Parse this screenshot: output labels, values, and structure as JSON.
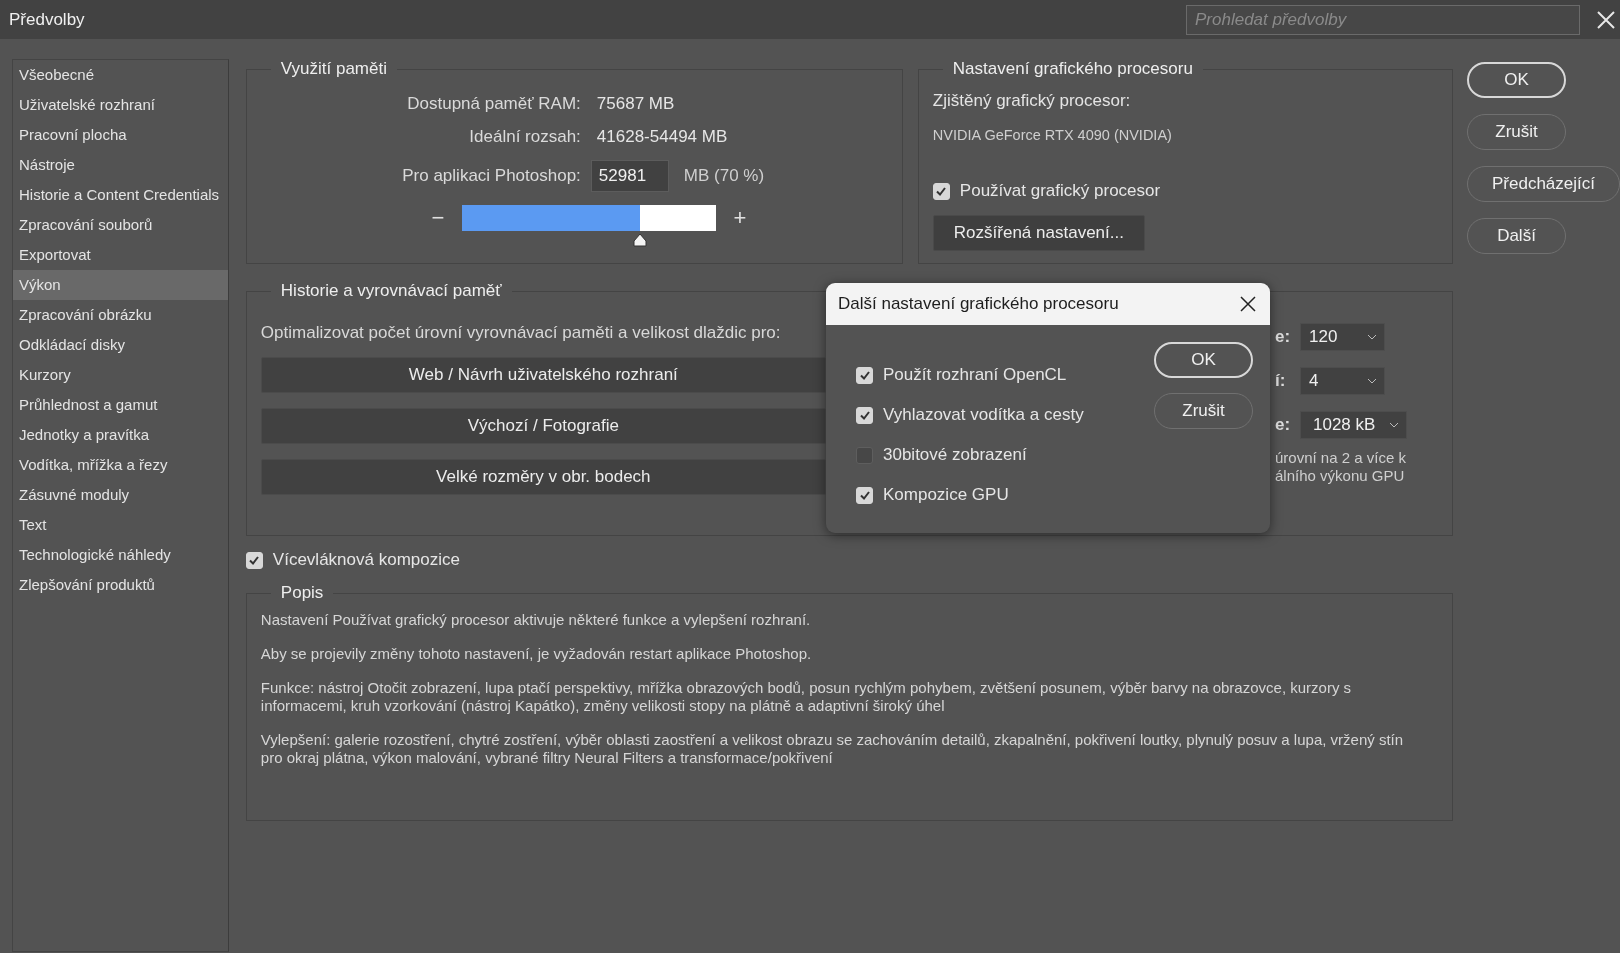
{
  "window": {
    "title": "Předvolby"
  },
  "search": {
    "placeholder": "Prohledat předvolby"
  },
  "sidebar": {
    "items": [
      {
        "label": "Všeobecné",
        "selected": false
      },
      {
        "label": "Uživatelské rozhraní",
        "selected": false
      },
      {
        "label": "Pracovní plocha",
        "selected": false
      },
      {
        "label": "Nástroje",
        "selected": false
      },
      {
        "label": "Historie a Content Credentials",
        "selected": false
      },
      {
        "label": "Zpracování souborů",
        "selected": false
      },
      {
        "label": "Exportovat",
        "selected": false
      },
      {
        "label": "Výkon",
        "selected": true
      },
      {
        "label": "Zpracování obrázku",
        "selected": false
      },
      {
        "label": "Odkládací disky",
        "selected": false
      },
      {
        "label": "Kurzory",
        "selected": false
      },
      {
        "label": "Průhlednost a gamut",
        "selected": false
      },
      {
        "label": "Jednotky a pravítka",
        "selected": false
      },
      {
        "label": "Vodítka, mřížka a řezy",
        "selected": false
      },
      {
        "label": "Zásuvné moduly",
        "selected": false
      },
      {
        "label": "Text",
        "selected": false
      },
      {
        "label": "Technologické náhledy",
        "selected": false
      },
      {
        "label": "Zlepšování produktů",
        "selected": false
      }
    ]
  },
  "memory": {
    "title": "Využití paměti",
    "rows": [
      {
        "label": "Dostupná paměť RAM:",
        "value": "75687 MB"
      },
      {
        "label": "Ideální rozsah:",
        "value": "41628-54494 MB"
      }
    ],
    "photoshop_label": "Pro aplikaci Photoshop:",
    "photoshop_value": "52981",
    "photoshop_unit": "MB (70 %)",
    "minus": "−",
    "plus": "+",
    "level": 0.7
  },
  "gpu": {
    "title": "Nastavení grafického procesoru",
    "detected_label": "Zjištěný grafický procesor:",
    "detected_value": "NVIDIA GeForce RTX 4090 (NVIDIA)",
    "use_gpu": {
      "label": "Používat grafický procesor",
      "checked": true
    },
    "advanced_button": "Rozšířená nastavení..."
  },
  "buttons": [
    "OK",
    "Zrušit",
    "Předcházející",
    "Další"
  ],
  "history": {
    "title": "Historie a vyrovnávací paměť",
    "optimize_label": "Optimalizovat počet úrovní vyrovnávací paměti a velikost dlaždic pro:",
    "presets": [
      "Web / Návrh uživatelského rozhraní",
      "Výchozí / Fotografie",
      "Velké rozměry v obr. bodech"
    ],
    "settings": [
      {
        "label": "e:",
        "value": "120"
      },
      {
        "label": "í:",
        "value": "4"
      },
      {
        "label": "e:",
        "value": "1028 kB"
      }
    ],
    "hint_lines": [
      "úrovní na 2 a více k",
      "álního výkonu GPU"
    ]
  },
  "multithreaded": {
    "label": "Vícevláknová kompozice",
    "checked": true
  },
  "description": {
    "title": "Popis",
    "paragraphs": [
      "Nastavení Používat grafický procesor aktivuje některé funkce a vylepšení rozhraní.",
      "Aby se projevily změny tohoto nastavení, je vyžadován restart aplikace Photoshop.",
      "Funkce: nástroj Otočit zobrazení, lupa ptačí perspektivy, mřížka obrazových bodů, posun rychlým pohybem, zvětšení posunem, výběr barvy na obrazovce, kurzory s informacemi, kruh vzorkování (nástroj Kapátko), změny velikosti stopy na plátně a adaptivní široký úhel",
      "Vylepšení: galerie rozostření, chytré zostření, výběr oblasti zaostření a velikost obrazu se zachováním detailů, zkapalnění, pokřivení loutky, plynulý posuv a lupa, vržený stín pro okraj plátna, výkon malování, vybrané filtry Neural Filters a transformace/pokřivení"
    ]
  },
  "dialog": {
    "title": "Další nastavení grafického procesoru",
    "options": [
      {
        "label": "Použít rozhraní OpenCL",
        "checked": true
      },
      {
        "label": "Vyhlazovat vodítka a cesty",
        "checked": true
      },
      {
        "label": "30bitové zobrazení",
        "checked": false
      },
      {
        "label": "Kompozice GPU",
        "checked": true
      }
    ],
    "buttons": [
      "OK",
      "Zrušit"
    ]
  }
}
